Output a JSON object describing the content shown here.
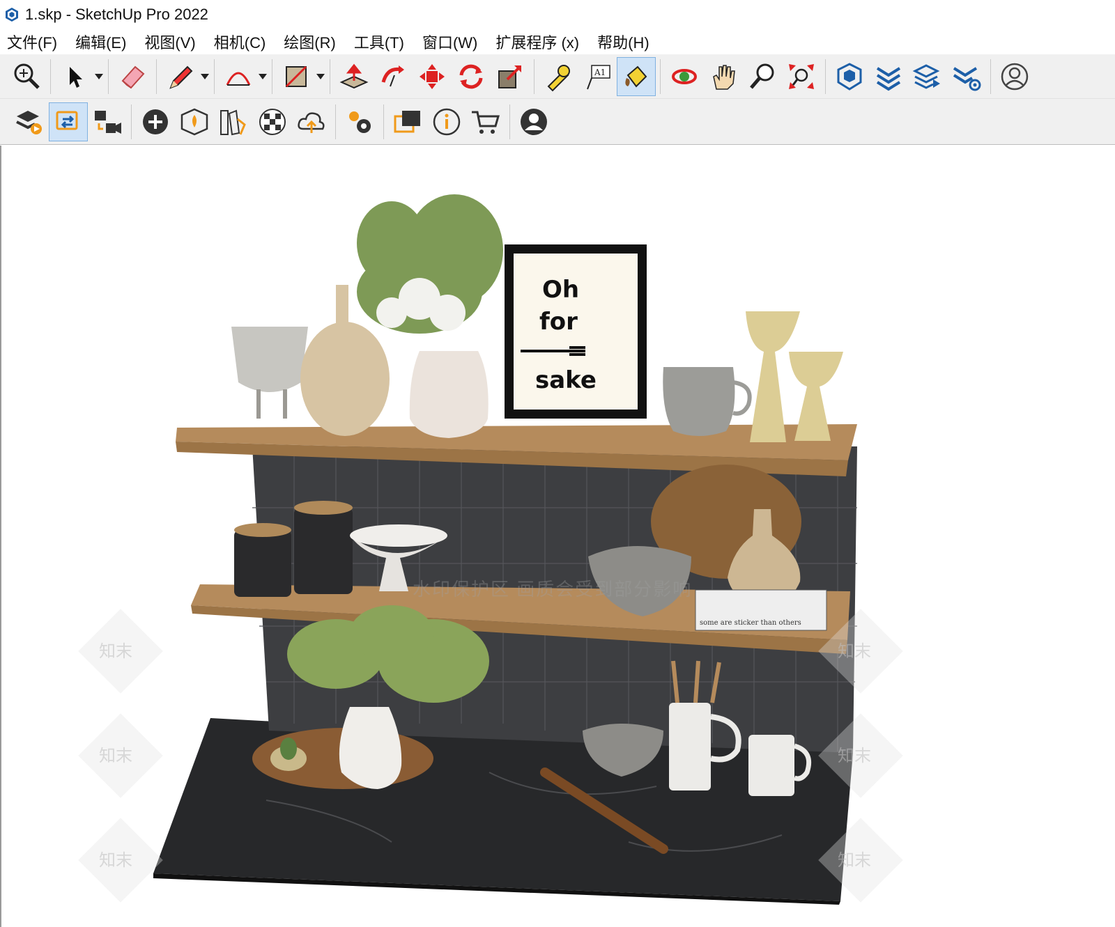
{
  "window": {
    "title": "1.skp - SketchUp Pro 2022"
  },
  "menu": {
    "items": [
      {
        "label": "文件(F)"
      },
      {
        "label": "编辑(E)"
      },
      {
        "label": "视图(V)"
      },
      {
        "label": "相机(C)"
      },
      {
        "label": "绘图(R)"
      },
      {
        "label": "工具(T)"
      },
      {
        "label": "窗口(W)"
      },
      {
        "label": "扩展程序 (x)"
      },
      {
        "label": "帮助(H)"
      }
    ]
  },
  "toolbar_main": {
    "tools": [
      {
        "name": "zoom-extents-icon"
      },
      {
        "name": "select-icon",
        "dropdown": true
      },
      {
        "name": "eraser-icon"
      },
      {
        "name": "pencil-line-icon",
        "dropdown": true
      },
      {
        "name": "arc-icon",
        "dropdown": true
      },
      {
        "name": "rectangle-icon",
        "dropdown": true
      },
      {
        "name": "push-pull-icon"
      },
      {
        "name": "follow-me-icon"
      },
      {
        "name": "move-icon"
      },
      {
        "name": "rotate-icon"
      },
      {
        "name": "scale-icon"
      },
      {
        "name": "tape-measure-icon"
      },
      {
        "name": "text-icon",
        "text": "A1"
      },
      {
        "name": "paint-bucket-icon",
        "active": true
      },
      {
        "name": "orbit-icon"
      },
      {
        "name": "pan-icon"
      },
      {
        "name": "zoom-icon"
      },
      {
        "name": "zoom-window-icon"
      },
      {
        "name": "3d-warehouse-icon"
      },
      {
        "name": "extension-warehouse-icon"
      },
      {
        "name": "layout-send-icon"
      },
      {
        "name": "extension-manager-icon"
      },
      {
        "name": "user-account-icon"
      }
    ]
  },
  "toolbar_secondary": {
    "tools": [
      {
        "name": "trimble-connect-icon"
      },
      {
        "name": "sync-icon",
        "active": true
      },
      {
        "name": "scene-camera-icon"
      },
      {
        "name": "add-location-icon"
      },
      {
        "name": "geo-terrain-icon"
      },
      {
        "name": "materials-palette-icon"
      },
      {
        "name": "checker-pattern-icon"
      },
      {
        "name": "cloud-upload-icon"
      },
      {
        "name": "settings-gears-icon"
      },
      {
        "name": "dialog-windows-icon"
      },
      {
        "name": "info-icon"
      },
      {
        "name": "cart-icon"
      },
      {
        "name": "profile-icon"
      }
    ]
  },
  "viewport": {
    "frame_text": [
      "Oh",
      "for",
      "sake"
    ],
    "book_text": "some are sticker than others",
    "watermark_banner": "水印保护区  画质会受到部分影响",
    "watermark_tile": "知末"
  },
  "colors": {
    "toolbar_bg": "#f0f0f0",
    "active_tool_bg": "#cfe3f7",
    "shelf_wood": "#a8825a",
    "wall_dark": "#3c3d40",
    "marble": "#252628"
  }
}
